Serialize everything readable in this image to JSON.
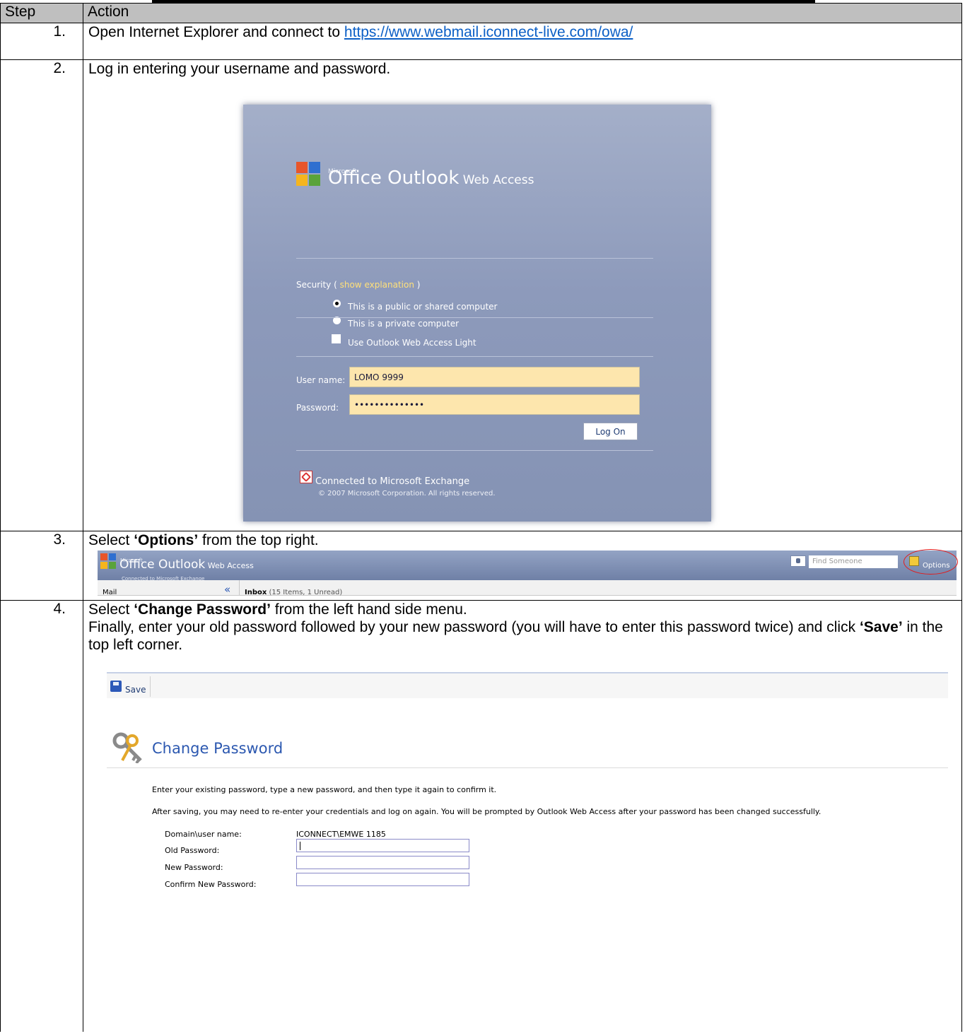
{
  "header": {
    "step": "Step",
    "action": "Action"
  },
  "steps": [
    {
      "num": "1.",
      "text": "Open Internet Explorer and connect to ",
      "link": "https://www.webmail.iconnect-live.com/owa/"
    },
    {
      "num": "2.",
      "text": "Log in entering your username and password."
    },
    {
      "num": "3.",
      "pre": "Select ",
      "bold": "‘Options’",
      "post": " from the top right."
    },
    {
      "num": "4.",
      "pre": "Select ",
      "bold": "‘Change Password’",
      "post": " from the left hand side menu.",
      "line2": "Finally, enter your old password followed by your new password (you will have to enter this password twice) and click ",
      "bold2": "‘Save’",
      "post2": " in the top left corner."
    }
  ],
  "login": {
    "microsoft": "Microsoft",
    "brand": "Office Outlook",
    "brand_small": " Web Access",
    "security_label": "Security (",
    "security_link": "show explanation",
    "security_close": ")",
    "option_public": "This is a public or shared computer",
    "option_private": "This is a private computer",
    "light": "Use Outlook Web Access Light",
    "username_label": "User name:",
    "username_value": "LOMO 9999",
    "password_label": "Password:",
    "password_value": "••••••••••••••",
    "logon_button": "Log On",
    "connected": "Connected to Microsoft Exchange",
    "copyright": "© 2007 Microsoft Corporation. All rights reserved."
  },
  "banner": {
    "microsoft": "Microsoft",
    "brand": "Office Outlook",
    "brand_small": " Web Access",
    "connected": "Connected to Microsoft Exchange",
    "find_placeholder": "Find Someone",
    "options": "Options",
    "mail": "Mail",
    "inbox": "Inbox",
    "inbox_count": " (15 Items, 1 Unread)"
  },
  "change_password": {
    "save": "Save",
    "title": "Change Password",
    "para1": "Enter your existing password, type a new password, and then type it again to confirm it.",
    "para2": "After saving, you may need to re-enter your credentials and log on again. You will be prompted by Outlook Web Access after your password has been changed successfully.",
    "domain_label": "Domain\\user name:",
    "domain_value": "ICONNECT\\EMWE 1185",
    "old_label": "Old Password:",
    "new_label": "New Password:",
    "confirm_label": "Confirm New Password:"
  },
  "colors": {
    "link": "#0b5fc6",
    "owa_blue": "#8593b4",
    "field_yellow": "#fde6ad",
    "title_blue": "#2c58b0",
    "highlight_ring": "#e21c1c"
  }
}
